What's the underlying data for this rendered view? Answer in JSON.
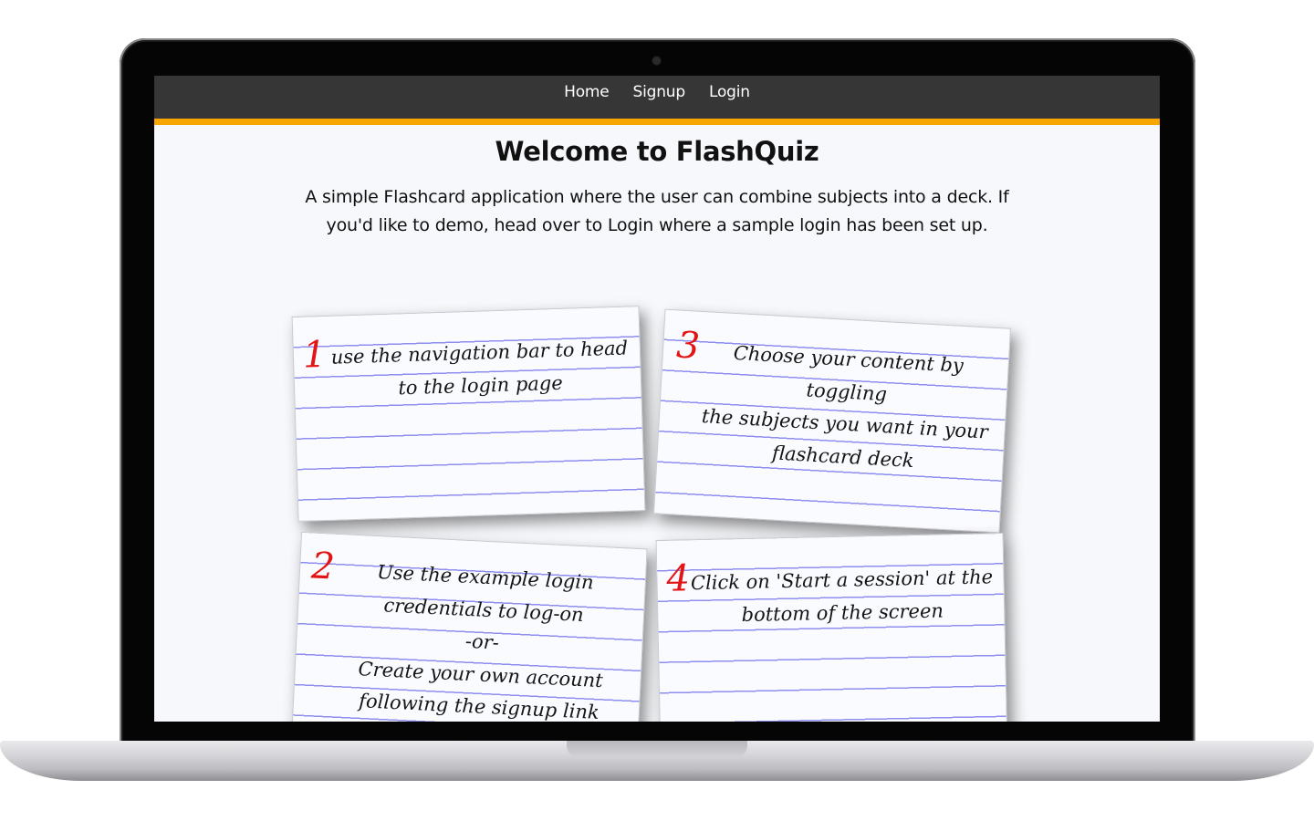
{
  "nav": {
    "links": [
      "Home",
      "Signup",
      "Login"
    ]
  },
  "hero": {
    "title": "Welcome to FlashQuiz",
    "intro_lines": [
      "A simple Flashcard application where the user can combine subjects into a",
      "deck. If you'd like to demo, head over to Login where a sample login has",
      "been set up."
    ]
  },
  "cards": [
    {
      "number": "1",
      "lines": [
        "use the navigation bar to head",
        "to the login page"
      ]
    },
    {
      "number": "3",
      "lines": [
        "Choose your content by toggling",
        "the subjects you want in your",
        "flashcard deck"
      ]
    },
    {
      "number": "2",
      "lines": [
        "Use the example login",
        "credentials to log-on",
        "-or-",
        "Create your own account",
        "following the signup link"
      ]
    },
    {
      "number": "4",
      "lines": [
        "Click on 'Start a session' at the",
        "bottom of the screen"
      ]
    }
  ],
  "colors": {
    "navbar": "#363636",
    "accent": "#f7a600",
    "card_number": "#e31414",
    "ruled_line": "#8e8ef0"
  }
}
